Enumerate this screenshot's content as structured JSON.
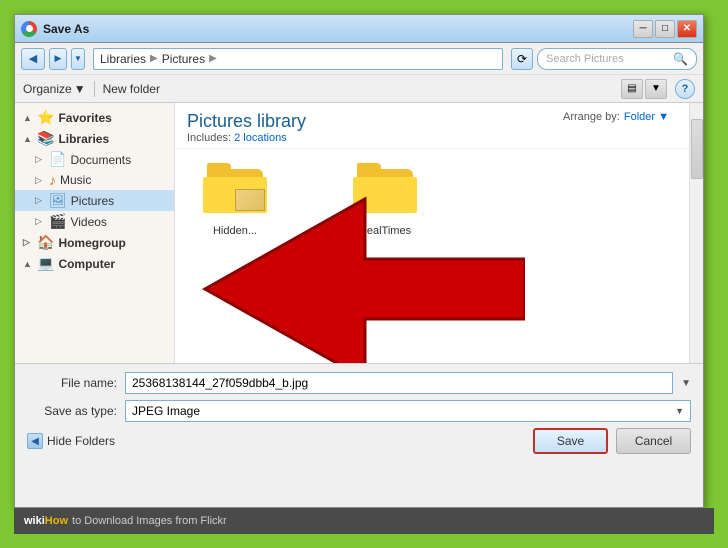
{
  "title_bar": {
    "title": "Save As",
    "close_label": "✕",
    "min_label": "─",
    "max_label": "□"
  },
  "nav_bar": {
    "back_label": "◀",
    "forward_label": "▶",
    "dropdown_label": "▼",
    "refresh_label": "⟳",
    "address": {
      "parts": [
        "Libraries",
        "Pictures"
      ],
      "separator": "▶"
    },
    "search_placeholder": "Search Pictures",
    "search_icon": "🔍"
  },
  "toolbar2": {
    "organize_label": "Organize",
    "organize_arrow": "▼",
    "new_folder_label": "New folder",
    "view_icon": "▤",
    "help_label": "?"
  },
  "left_panel": {
    "items": [
      {
        "id": "favorites",
        "label": "Favorites",
        "icon": "⭐",
        "indent": 0,
        "expand": "▲",
        "bold": true
      },
      {
        "id": "libraries",
        "label": "Libraries",
        "icon": "📚",
        "indent": 0,
        "expand": "▲",
        "bold": true
      },
      {
        "id": "documents",
        "label": "Documents",
        "icon": "📄",
        "indent": 1,
        "expand": "▷"
      },
      {
        "id": "music",
        "label": "Music",
        "icon": "♪",
        "indent": 1,
        "expand": "▷"
      },
      {
        "id": "pictures",
        "label": "Pictures",
        "icon": "🖼",
        "indent": 1,
        "expand": "▷",
        "selected": true
      },
      {
        "id": "videos",
        "label": "Videos",
        "icon": "🎬",
        "indent": 1,
        "expand": "▷"
      },
      {
        "id": "homegroup",
        "label": "Homegroup",
        "icon": "🏠",
        "indent": 0,
        "expand": "▷",
        "bold": true
      },
      {
        "id": "computer",
        "label": "Computer",
        "icon": "💻",
        "indent": 0,
        "expand": "▲",
        "bold": true
      }
    ]
  },
  "content": {
    "title": "Pictures library",
    "subtitle_pre": "Includes:",
    "subtitle_link": "2 locations",
    "arrange_label": "Arrange by:",
    "arrange_value": "Folder",
    "arrange_arrow": "▼",
    "folders": [
      {
        "name": "Hidden...",
        "has_thumb": true
      },
      {
        "name": "RealTimes",
        "has_thumb": false
      }
    ]
  },
  "bottom_form": {
    "filename_label": "File name:",
    "filename_value": "25368138144_27f059dbb4_b.jpg",
    "savetype_label": "Save as type:",
    "savetype_value": "JPEG Image",
    "hide_folders_label": "Hide Folders",
    "save_label": "Save",
    "cancel_label": "Cancel"
  },
  "footer": {
    "wiki_label": "wiki",
    "how_label": "How",
    "text": "to Download Images from Flickr"
  }
}
